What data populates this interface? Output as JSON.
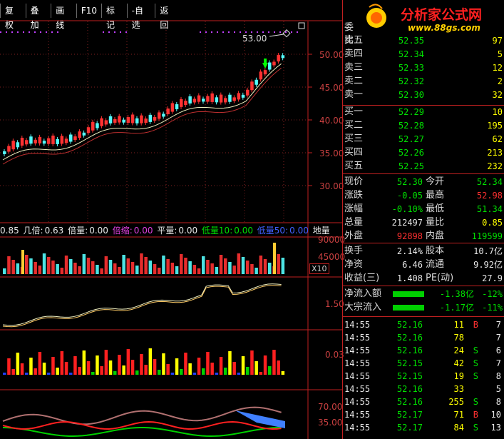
{
  "toolbar": {
    "buttons": [
      "复权",
      "叠加",
      "画线",
      "F10",
      "标记",
      "-自选",
      "返回"
    ]
  },
  "logo": {
    "title": "分析家公式网",
    "url": "www.88gs.com"
  },
  "price_axis": {
    "labels": [
      "50.00",
      "45.00",
      "40.00",
      "35.00",
      "30.00"
    ],
    "current_price_label": "53.00"
  },
  "indicator_bar": {
    "a_value": "0.85",
    "ji_bei_label": "几倍:",
    "ji_bei_value": "0.63",
    "bei_liang_label": "倍量:",
    "bei_liang_value": "0.00",
    "bei_zhi_label": "倍缩:",
    "bei_zhi_value": "0.00",
    "ping_liang_label": "平量:",
    "ping_liang_value": "0.00",
    "di_liang10_label": "低量10:",
    "di_liang10_value": "0.00",
    "di_liang50_label": "低量50:",
    "di_liang50_value": "0.00",
    "di_liang_label": "地量"
  },
  "volume_axis": {
    "labels": [
      "90000",
      "45000"
    ],
    "unit": "X10"
  },
  "osc1_axis": {
    "label": "1.50"
  },
  "osc2_axis": {
    "label": "0.03"
  },
  "osc3_axis": {
    "labels": [
      "70.00",
      "35.00"
    ]
  },
  "order_book": {
    "header": "委比",
    "sell": [
      {
        "label": "卖五",
        "price": "52.35",
        "vol": "97"
      },
      {
        "label": "卖四",
        "price": "52.34",
        "vol": "5"
      },
      {
        "label": "卖三",
        "price": "52.33",
        "vol": "12"
      },
      {
        "label": "卖二",
        "price": "52.32",
        "vol": "2"
      },
      {
        "label": "卖一",
        "price": "52.30",
        "vol": "32"
      }
    ],
    "buy": [
      {
        "label": "买一",
        "price": "52.29",
        "vol": "10"
      },
      {
        "label": "买二",
        "price": "52.28",
        "vol": "195"
      },
      {
        "label": "买三",
        "price": "52.27",
        "vol": "62"
      },
      {
        "label": "买四",
        "price": "52.26",
        "vol": "213"
      },
      {
        "label": "买五",
        "price": "52.25",
        "vol": "232"
      }
    ]
  },
  "quote": [
    {
      "l1": "现价",
      "v1": "52.30",
      "c1": "green",
      "l2": "今开",
      "v2": "52.34",
      "c2": "green"
    },
    {
      "l1": "涨跌",
      "v1": "-0.05",
      "c1": "green",
      "l2": "最高",
      "v2": "52.98",
      "c2": "red"
    },
    {
      "l1": "涨幅",
      "v1": "-0.10%",
      "c1": "green",
      "l2": "最低",
      "v2": "51.34",
      "c2": "green"
    },
    {
      "l1": "总量",
      "v1": "212497",
      "c1": "white",
      "l2": "量比",
      "v2": "0.85",
      "c2": "yellow"
    },
    {
      "l1": "外盘",
      "v1": "92898",
      "c1": "red",
      "l2": "内盘",
      "v2": "119599",
      "c2": "green"
    }
  ],
  "finance": [
    {
      "l1": "换手",
      "v1": "2.14%",
      "l2": "股本",
      "v2": "10.7亿"
    },
    {
      "l1": "净资",
      "v1": "6.46",
      "l2": "流通",
      "v2": "9.92亿"
    },
    {
      "l1": "收益(三)",
      "v1": "1.408",
      "l2": "PE(动)",
      "v2": "27.9"
    }
  ],
  "flows": [
    {
      "label": "净流入额",
      "value": "-1.38亿",
      "pct": "-12%"
    },
    {
      "label": "大宗流入",
      "value": "-1.17亿",
      "pct": "-11%"
    }
  ],
  "ticks": [
    {
      "t": "14:55",
      "p": "52.16",
      "v": "11",
      "s": "B",
      "n": "7"
    },
    {
      "t": "14:55",
      "p": "52.16",
      "v": "78",
      "s": "",
      "n": "7"
    },
    {
      "t": "14:55",
      "p": "52.16",
      "v": "24",
      "s": "S",
      "n": "6"
    },
    {
      "t": "14:55",
      "p": "52.15",
      "v": "42",
      "s": "S",
      "n": "7"
    },
    {
      "t": "14:55",
      "p": "52.15",
      "v": "19",
      "s": "S",
      "n": "8"
    },
    {
      "t": "14:55",
      "p": "52.16",
      "v": "33",
      "s": "",
      "n": "5"
    },
    {
      "t": "14:55",
      "p": "52.16",
      "v": "255",
      "s": "S",
      "n": "8"
    },
    {
      "t": "14:55",
      "p": "52.17",
      "v": "71",
      "s": "B",
      "n": "10"
    },
    {
      "t": "14:55",
      "p": "52.17",
      "v": "84",
      "s": "S",
      "n": "13"
    }
  ],
  "colors": {
    "up": "#ff3232",
    "down": "#54fcfc",
    "ma1": "#f0f0c0",
    "ma2": "#c03030",
    "grid": "#c02020",
    "bg": "#000000"
  }
}
